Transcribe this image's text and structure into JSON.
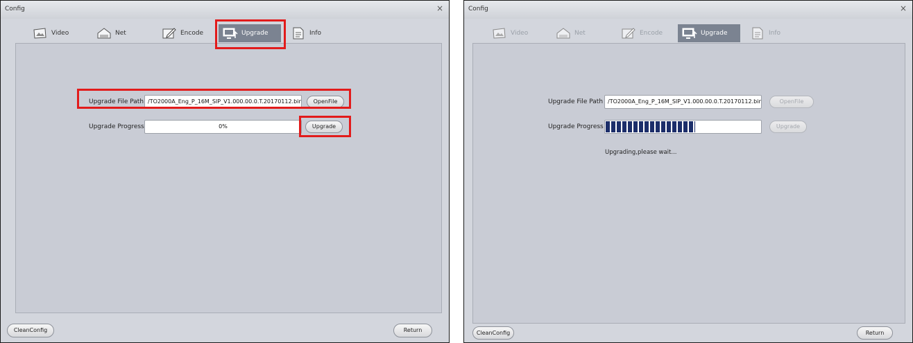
{
  "left": {
    "title": "Config",
    "close": "×",
    "tabs": {
      "video": "Video",
      "net": "Net",
      "encode": "Encode",
      "upgrade": "Upgrade",
      "info": "Info"
    },
    "file_label": "Upgrade File Path",
    "file_path": "/TO2000A_Eng_P_16M_SIP_V1.000.00.0.T.20170112.bin",
    "openfile": "OpenFile",
    "progress_label": "Upgrade Progress",
    "progress_text": "0%",
    "progress_value": 0,
    "upgrade_btn": "Upgrade",
    "clean": "CleanConfig",
    "return": "Return"
  },
  "right": {
    "title": "Config",
    "close": "×",
    "tabs": {
      "video": "Video",
      "net": "Net",
      "encode": "Encode",
      "upgrade": "Upgrade",
      "info": "Info"
    },
    "file_label": "Upgrade File Path",
    "file_path": "/TO2000A_Eng_P_16M_SIP_V1.000.00.0.T.20170112.bin",
    "openfile": "OpenFile",
    "progress_label": "Upgrade Progress",
    "progress_value": 0.58,
    "upgrade_btn": "Upgrade",
    "status": "Upgrading,please wait...",
    "clean": "CleanConfig",
    "return": "Return"
  },
  "colors": {
    "highlight": "#e21b1b",
    "progress_fill": "#1c2e6a",
    "active_tab": "#7b8391"
  }
}
